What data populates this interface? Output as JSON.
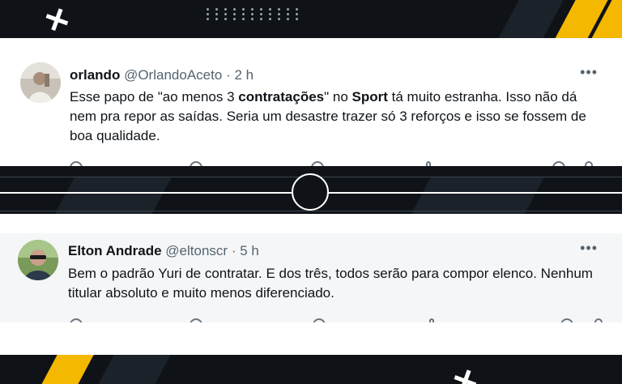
{
  "tweets": [
    {
      "display_name": "orlando",
      "handle": "@OrlandoAceto",
      "time": "2 h",
      "text_1": "Esse papo de \"ao menos 3 ",
      "text_bold_1": "contratações",
      "text_2": "\" no ",
      "text_bold_2": "Sport",
      "text_3": " tá muito estranha. Isso não dá nem pra repor as saídas. Seria um desastre trazer só 3 reforços e isso se fossem de boa qualidade.",
      "more_label": "•••",
      "separator": "·"
    },
    {
      "display_name": "Elton Andrade",
      "handle": "@eltonscr",
      "time": "5 h",
      "text": "Bem o padrão Yuri de contratar. E dos três, todos serão para compor elenco. Nenhum titular absoluto e muito menos diferenciado.",
      "more_label": "•••",
      "separator": "·"
    }
  ],
  "colors": {
    "background": "#0f1317",
    "accent": "#f5b800",
    "text_primary": "#0f1419",
    "text_secondary": "#536471"
  }
}
